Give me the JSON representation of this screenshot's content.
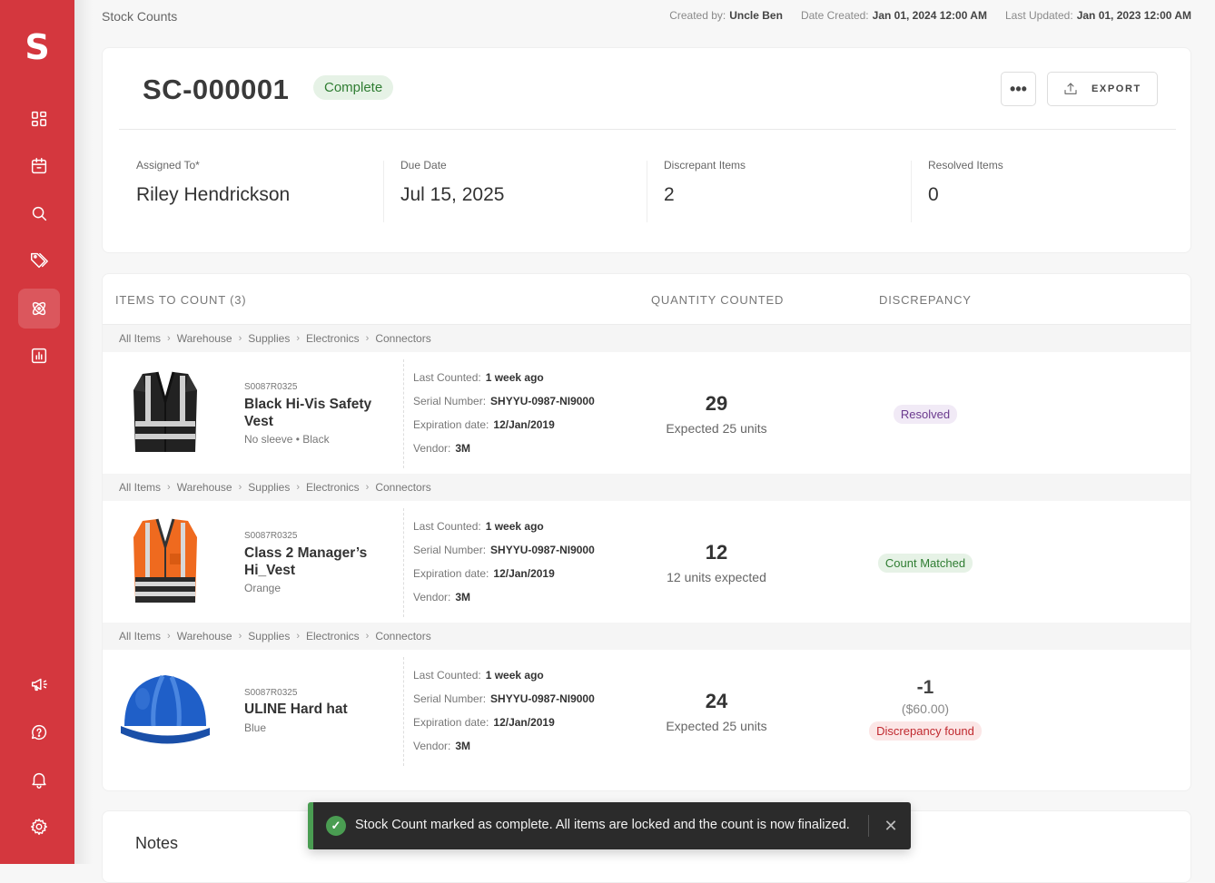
{
  "app": {
    "logo_letter": "S",
    "brand_color": "#d4373e"
  },
  "sidebar": {
    "items": [
      {
        "name": "dashboard",
        "icon": "grid-icon"
      },
      {
        "name": "calendar",
        "icon": "calendar-icon"
      },
      {
        "name": "search",
        "icon": "search-icon"
      },
      {
        "name": "tags",
        "icon": "tags-icon"
      },
      {
        "name": "stock-counts",
        "icon": "atom-icon",
        "active": true
      },
      {
        "name": "reports",
        "icon": "bar-chart-icon"
      }
    ],
    "bottom_items": [
      {
        "name": "announcements",
        "icon": "megaphone-icon"
      },
      {
        "name": "help",
        "icon": "help-icon"
      },
      {
        "name": "notifications",
        "icon": "bell-icon"
      },
      {
        "name": "settings",
        "icon": "gear-icon"
      }
    ]
  },
  "topbar": {
    "title": "Stock Counts",
    "created_by_label": "Created by:",
    "created_by": "Uncle Ben",
    "date_created_label": "Date Created:",
    "date_created": "Jan 01, 2024 12:00 AM",
    "last_updated_label": "Last Updated:",
    "last_updated": "Jan 01, 2023 12:00 AM"
  },
  "header": {
    "id": "SC-000001",
    "status": "Complete",
    "more_label": "•••",
    "export_label": "EXPORT",
    "stats": [
      {
        "label": "Assigned To*",
        "value": "Riley Hendrickson"
      },
      {
        "label": "Due Date",
        "value": "Jul 15, 2025"
      },
      {
        "label": "Discrepant Items",
        "value": "2"
      },
      {
        "label": "Resolved Items",
        "value": "0"
      }
    ]
  },
  "table": {
    "headers": {
      "items": "ITEMS TO COUNT (3)",
      "quantity": "QUANTITY COUNTED",
      "discrepancy": "DISCREPANCY"
    },
    "path": [
      "All Items",
      "Warehouse",
      "Supplies",
      "Electronics",
      "Connectors"
    ],
    "path_sep": "›",
    "detail_labels": {
      "last_counted": "Last Counted:",
      "serial": "Serial Number:",
      "expiration": "Expiration date:",
      "vendor": "Vendor:"
    },
    "rows": [
      {
        "sku": "S0087R0325",
        "name": "Black Hi-Vis Safety Vest",
        "variant": "No sleeve • Black",
        "last_counted": "1 week ago",
        "serial": "SHYYU-0987-NI9000",
        "expiration": "12/Jan/2019",
        "vendor": "3M",
        "qty": "29",
        "qty_sub": "Expected 25 units",
        "badge": "Resolved"
      },
      {
        "sku": "S0087R0325",
        "name": "Class 2 Manager’s Hi_Vest",
        "variant": "Orange",
        "last_counted": "1 week ago",
        "serial": "SHYYU-0987-NI9000",
        "expiration": "12/Jan/2019",
        "vendor": "3M",
        "qty": "12",
        "qty_sub": "12 units expected",
        "badge": "Count Matched"
      },
      {
        "sku": "S0087R0325",
        "name": "ULINE Hard hat",
        "variant": "Blue",
        "last_counted": "1 week ago",
        "serial": "SHYYU-0987-NI9000",
        "expiration": "12/Jan/2019",
        "vendor": "3M",
        "qty": "24",
        "qty_sub": "Expected 25 units",
        "disc_value": "-1",
        "disc_amount": "($60.00)",
        "badge": "Discrepancy found"
      }
    ]
  },
  "notes": {
    "title": "Notes"
  },
  "toast": {
    "message": "Stock Count marked as complete. All items are locked and the count is now finalized.",
    "close": "✕",
    "check": "✓"
  }
}
